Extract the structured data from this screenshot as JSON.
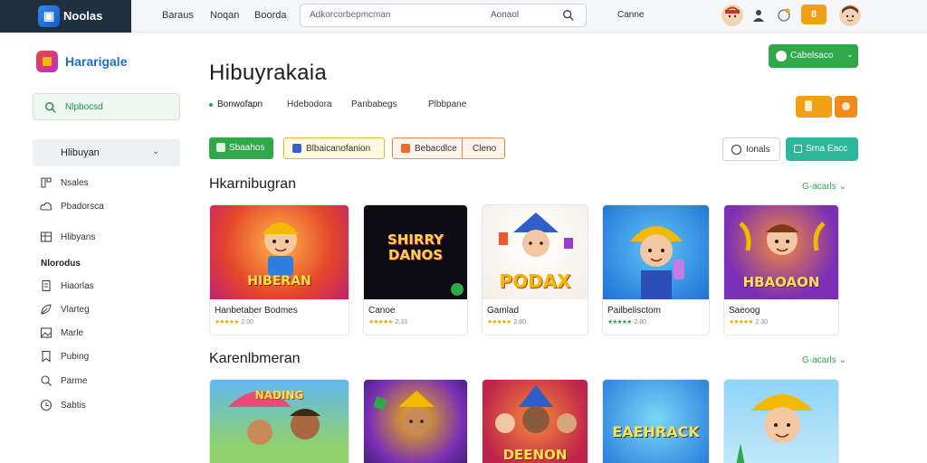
{
  "topbar": {
    "brand": "Noolas",
    "nav": [
      "Baraus",
      "Noqan",
      "Boorda"
    ],
    "search_placeholder": "Adkorcorbepmcman",
    "search_scope": "Aonaol",
    "link": "Canne",
    "badge": "8"
  },
  "sidebar": {
    "title": "Hararigale",
    "search_label": "Nlpbocsd",
    "category": "Hlibuyan",
    "items_top": [
      {
        "label": "Nsales",
        "icon": "grid-icon"
      },
      {
        "label": "Pbadorsca",
        "icon": "cloud-icon"
      },
      {
        "label": "Hlibyans",
        "icon": "table-icon"
      }
    ],
    "heading": "Nlorodus",
    "items_bottom": [
      {
        "label": "Hiaorlas",
        "icon": "document-icon"
      },
      {
        "label": "Vlarteg",
        "icon": "leaf-icon"
      },
      {
        "label": "Marle",
        "icon": "image-icon"
      },
      {
        "label": "Pubing",
        "icon": "bookmark-icon"
      },
      {
        "label": "Parme",
        "icon": "search-icon"
      },
      {
        "label": "Sabtis",
        "icon": "clock-icon"
      }
    ]
  },
  "main": {
    "title": "Hibuyrakaia",
    "tabs": [
      "Bonwofapn",
      "Hdebodora",
      "Panbabegs",
      "Plbbpane"
    ],
    "cta": "Cabelsaco",
    "chips": {
      "green": "Sbaahos",
      "yellow": "Blbaicanofanion",
      "orange_left": "Bebacdlce",
      "orange_right": "Cleno"
    },
    "filter_button": "Ionals",
    "teal_button": "Srna Eacc",
    "section1": {
      "title": "Hkarnibugran",
      "see_all": "G-acarls",
      "cards": [
        {
          "name": "Hanbetaber Bodmes",
          "meta": "2.00",
          "art_text": "HIBERAN"
        },
        {
          "name": "Canoe",
          "meta": "2.33",
          "art_text": "SHIRRY DANOS"
        },
        {
          "name": "Gamlad",
          "meta": "2.80",
          "art_text": "PODAX"
        },
        {
          "name": "Pailbelisctom",
          "meta": "2.80",
          "art_text": ""
        },
        {
          "name": "Saeoog",
          "meta": "2.30",
          "art_text": "HBAOAON"
        }
      ]
    },
    "section2": {
      "title": "Karenlbmeran",
      "see_all": "G-acarls",
      "cards": [
        {
          "art_text": "NADING"
        },
        {
          "art_text": ""
        },
        {
          "art_text": "DEENON"
        },
        {
          "art_text": "EAEHRACK"
        },
        {
          "art_text": ""
        }
      ]
    }
  },
  "colors": {
    "accent_green": "#2fa84a",
    "brand_dark": "#1f2f3f",
    "orange": "#f4a014",
    "teal": "#2cb79a",
    "star": "#f1a90b"
  }
}
